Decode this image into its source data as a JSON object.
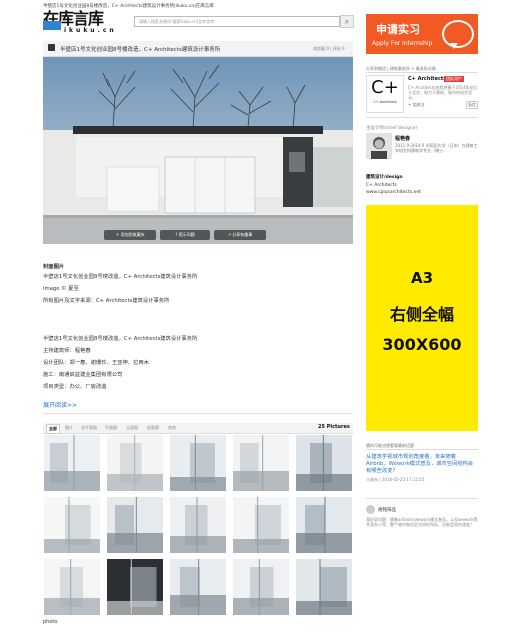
{
  "header": {
    "top_title": "半壁店1号文化创业园8号楼改造，C+ Architects建筑设计事务所|ikuku.cn|在库言库",
    "logo_main": "在库言库",
    "logo_sub": "ikuku.cn",
    "search_placeholder": "请输入搜索关键词 搜索ikuku.cn|在库言库",
    "search_icon": "search-icon"
  },
  "banner": {
    "title": "申请实习",
    "subtitle": "Apply For Internship",
    "color": "#f15a22",
    "icon": "chat-bubble-icon"
  },
  "titlebar": {
    "title": "半壁店1号文化创业园8号楼改造，C+ Architects建筑设计事务所",
    "views": "浏览量 0",
    "comments": "评论 0"
  },
  "hero_actions": [
    "添加到收藏夹",
    "提示问题",
    "分享有趣事"
  ],
  "article": {
    "cover_heading": "封面图片",
    "cover_lines": [
      "半壁店1号文化创业园8号楼改造，C+ Architects建筑设计事务所",
      "image © 夏至",
      "所有图片及文字来源：C+ Architects建筑设计事务所"
    ],
    "info_lines": [
      "半壁店1号文化创业园8号楼改造，C+ Architects建筑设计事务所",
      "主持建筑师：程艳春",
      "设计团队：郑一春、谢珊珍、王亚坤、拉西木",
      "施工：南通启益建业集团有限公司",
      "项目类型：办公、厂房改造"
    ],
    "expand": "展开阅读>>"
  },
  "gallery": {
    "tabs": [
      "全部",
      "图片",
      "总平面图",
      "平面图",
      "立面图",
      "剖面图",
      "其他"
    ],
    "count": "25 Pictures",
    "caption": "photo"
  },
  "sidebar": {
    "firm_head": "分享到微信 | 建筑事务所 > 事务所详情",
    "firm_name": "C+ Architects",
    "firm_badge": "团队用户",
    "firm_desc": "C+ Architects由程艳春于2014年创立于北京，致力于建筑、城市的研究设计。",
    "firm_follow": "+ 加关注",
    "firm_msg": "私信",
    "designer_head": "主设计师/chief designer",
    "designer_name": "程艳春",
    "designer_desc": "2011.9-2014.9 早稻田大学（日本）在建筑工学研究科建筑学专业（博士...",
    "firm_label": "建筑设计/design",
    "firm_label_value": "C+ Architects",
    "firm_url": "www.cplusarchitects.net"
  },
  "ad": {
    "line1": "A3",
    "line2": "右侧全幅",
    "line3": "300X600",
    "color": "#ffeb00"
  },
  "related": {
    "head": "猜你可能也想看看最新话题",
    "title": "从建筑学视城市规划角度看，未来随着Airbnb、Wework模式普及，城市空间结构会有哪些改变？",
    "meta": "马海东 | 2016-03-25 17:12:25",
    "user_name": "胡铭阳品",
    "user_text": "我好奇问题：随着airbnb与wework模式普及，以及wework等共享办公等，整个城市和社区空间的布局、功能会如何改变？"
  }
}
